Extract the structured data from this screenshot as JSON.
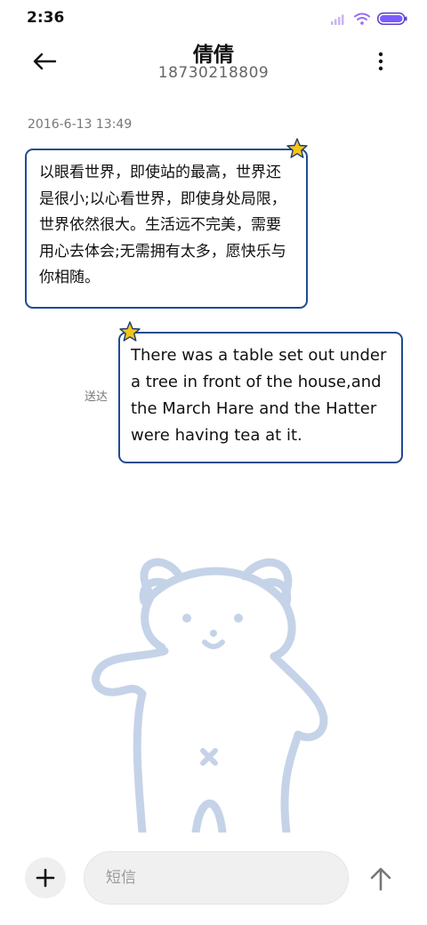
{
  "status_bar": {
    "time": "2:36",
    "icons": [
      "signal-icon",
      "wifi-icon",
      "battery-icon"
    ],
    "battery_color": "#7a5cff"
  },
  "header": {
    "contact_name": "倩倩",
    "contact_number": "18730218809",
    "back_icon": "arrow-left-icon",
    "more_icon": "vertical-dots-icon"
  },
  "conversation": {
    "timestamp": "2016-6-13 13:49",
    "messages": [
      {
        "direction": "incoming",
        "text": "以眼看世界，即使站的最高，世界还是很小;以心看世界，即使身处局限，世界依然很大。生活远不完美，需要用心去体会;无需拥有太多，愿快乐与你相随。"
      },
      {
        "direction": "outgoing",
        "text": "There was a table set out under a tree in front of the house,and the March Hare and the Hatter were having tea at it.",
        "status": "送达"
      }
    ],
    "bubble_border_color": "#1f4c8f",
    "star_color": "#f5c518"
  },
  "background": {
    "illustration": "bear-outline",
    "color": "#c5d3e8"
  },
  "input_bar": {
    "add_icon": "plus-icon",
    "placeholder": "短信",
    "value": "",
    "send_icon": "arrow-up-icon"
  }
}
